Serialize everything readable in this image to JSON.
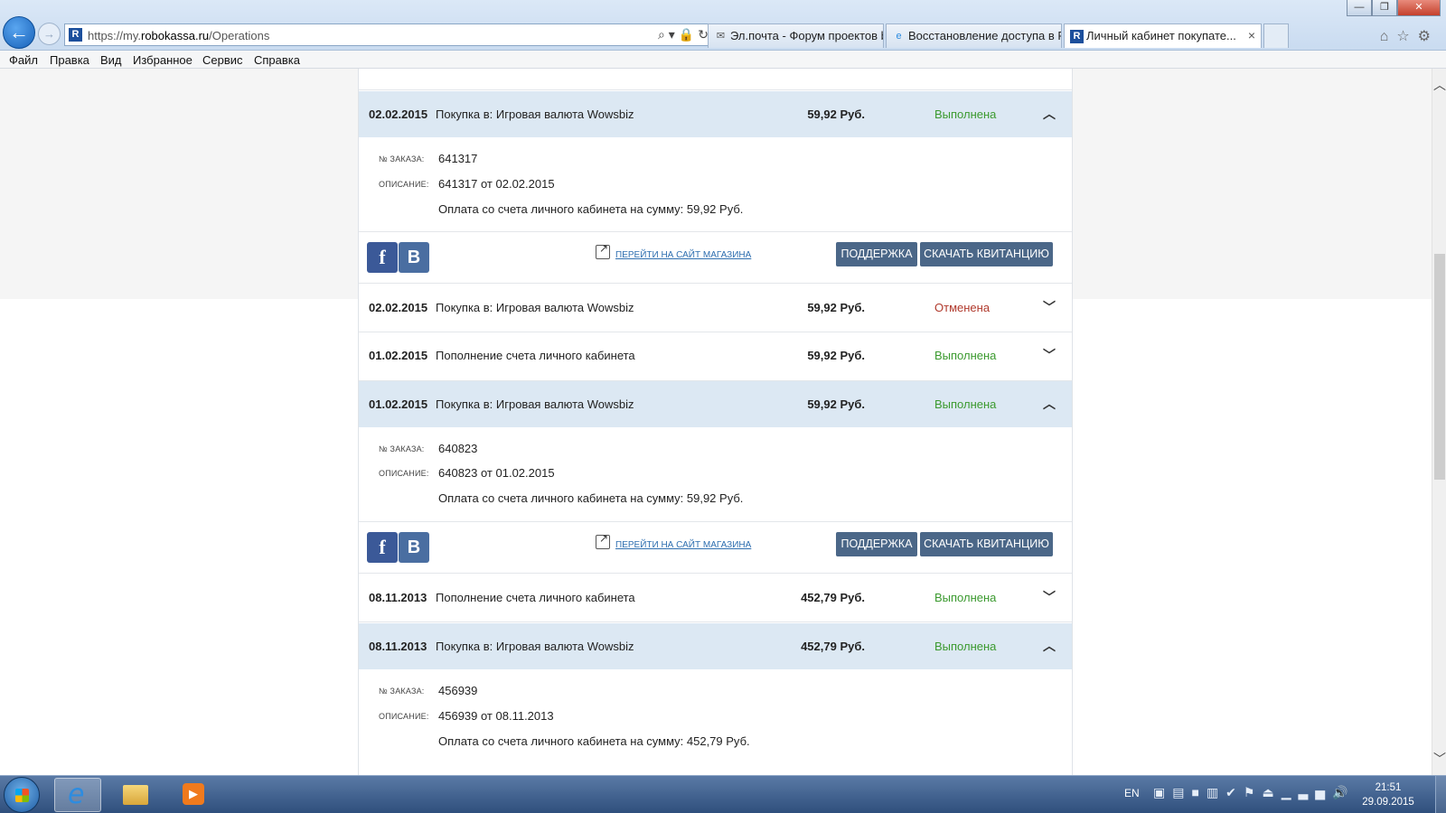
{
  "browser": {
    "url_prefix": "https://my.",
    "url_domain": "robokassa.ru",
    "url_path": "/Operations",
    "tabs": [
      {
        "label": "Эл.почта - Форум проектов b..."
      },
      {
        "label": "Восстановление доступа в R..."
      },
      {
        "label": "Личный кабинет покупате..."
      }
    ],
    "favicon_letter": "R"
  },
  "menu": [
    "Файл",
    "Правка",
    "Вид",
    "Избранное",
    "Сервис",
    "Справка"
  ],
  "labels": {
    "order_no": "№ заказа:",
    "description": "Описание:",
    "shop_link": "Перейти на сайт магазина",
    "support": "Поддержка",
    "receipt": "Скачать квитанцию",
    "fb": "f",
    "vk": "B"
  },
  "operations": [
    {
      "date": "02.02.2015",
      "description": "Покупка в: Игровая валюта Wowsbiz",
      "amount": "59,92 Руб.",
      "status": "Выполнена",
      "expanded": true,
      "order_no": "641317",
      "order_desc": "641317 от 02.02.2015",
      "payment_note": "Оплата со счета личного кабинета на сумму: 59,92 Руб."
    },
    {
      "date": "02.02.2015",
      "description": "Покупка в: Игровая валюта Wowsbiz",
      "amount": "59,92 Руб.",
      "status": "Отменена",
      "expanded": false
    },
    {
      "date": "01.02.2015",
      "description": "Пополнение счета личного кабинета",
      "amount": "59,92 Руб.",
      "status": "Выполнена",
      "expanded": false
    },
    {
      "date": "01.02.2015",
      "description": "Покупка в: Игровая валюта Wowsbiz",
      "amount": "59,92 Руб.",
      "status": "Выполнена",
      "expanded": true,
      "order_no": "640823",
      "order_desc": "640823 от 01.02.2015",
      "payment_note": "Оплата со счета личного кабинета на сумму: 59,92 Руб."
    },
    {
      "date": "08.11.2013",
      "description": "Пополнение счета личного кабинета",
      "amount": "452,79 Руб.",
      "status": "Выполнена",
      "expanded": false
    },
    {
      "date": "08.11.2013",
      "description": "Покупка в: Игровая валюта Wowsbiz",
      "amount": "452,79 Руб.",
      "status": "Выполнена",
      "expanded": true,
      "order_no": "456939",
      "order_desc": "456939 от 08.11.2013",
      "payment_note": "Оплата со счета личного кабинета на сумму: 452,79 Руб."
    }
  ],
  "taskbar": {
    "lang": "EN",
    "time": "21:51",
    "date": "29.09.2015"
  },
  "colors": {
    "status_ok": "#3b9a2f",
    "status_cancelled": "#b0392c",
    "expanded_header": "#dce8f3",
    "button": "#4b6788",
    "link": "#2f6fb0"
  }
}
